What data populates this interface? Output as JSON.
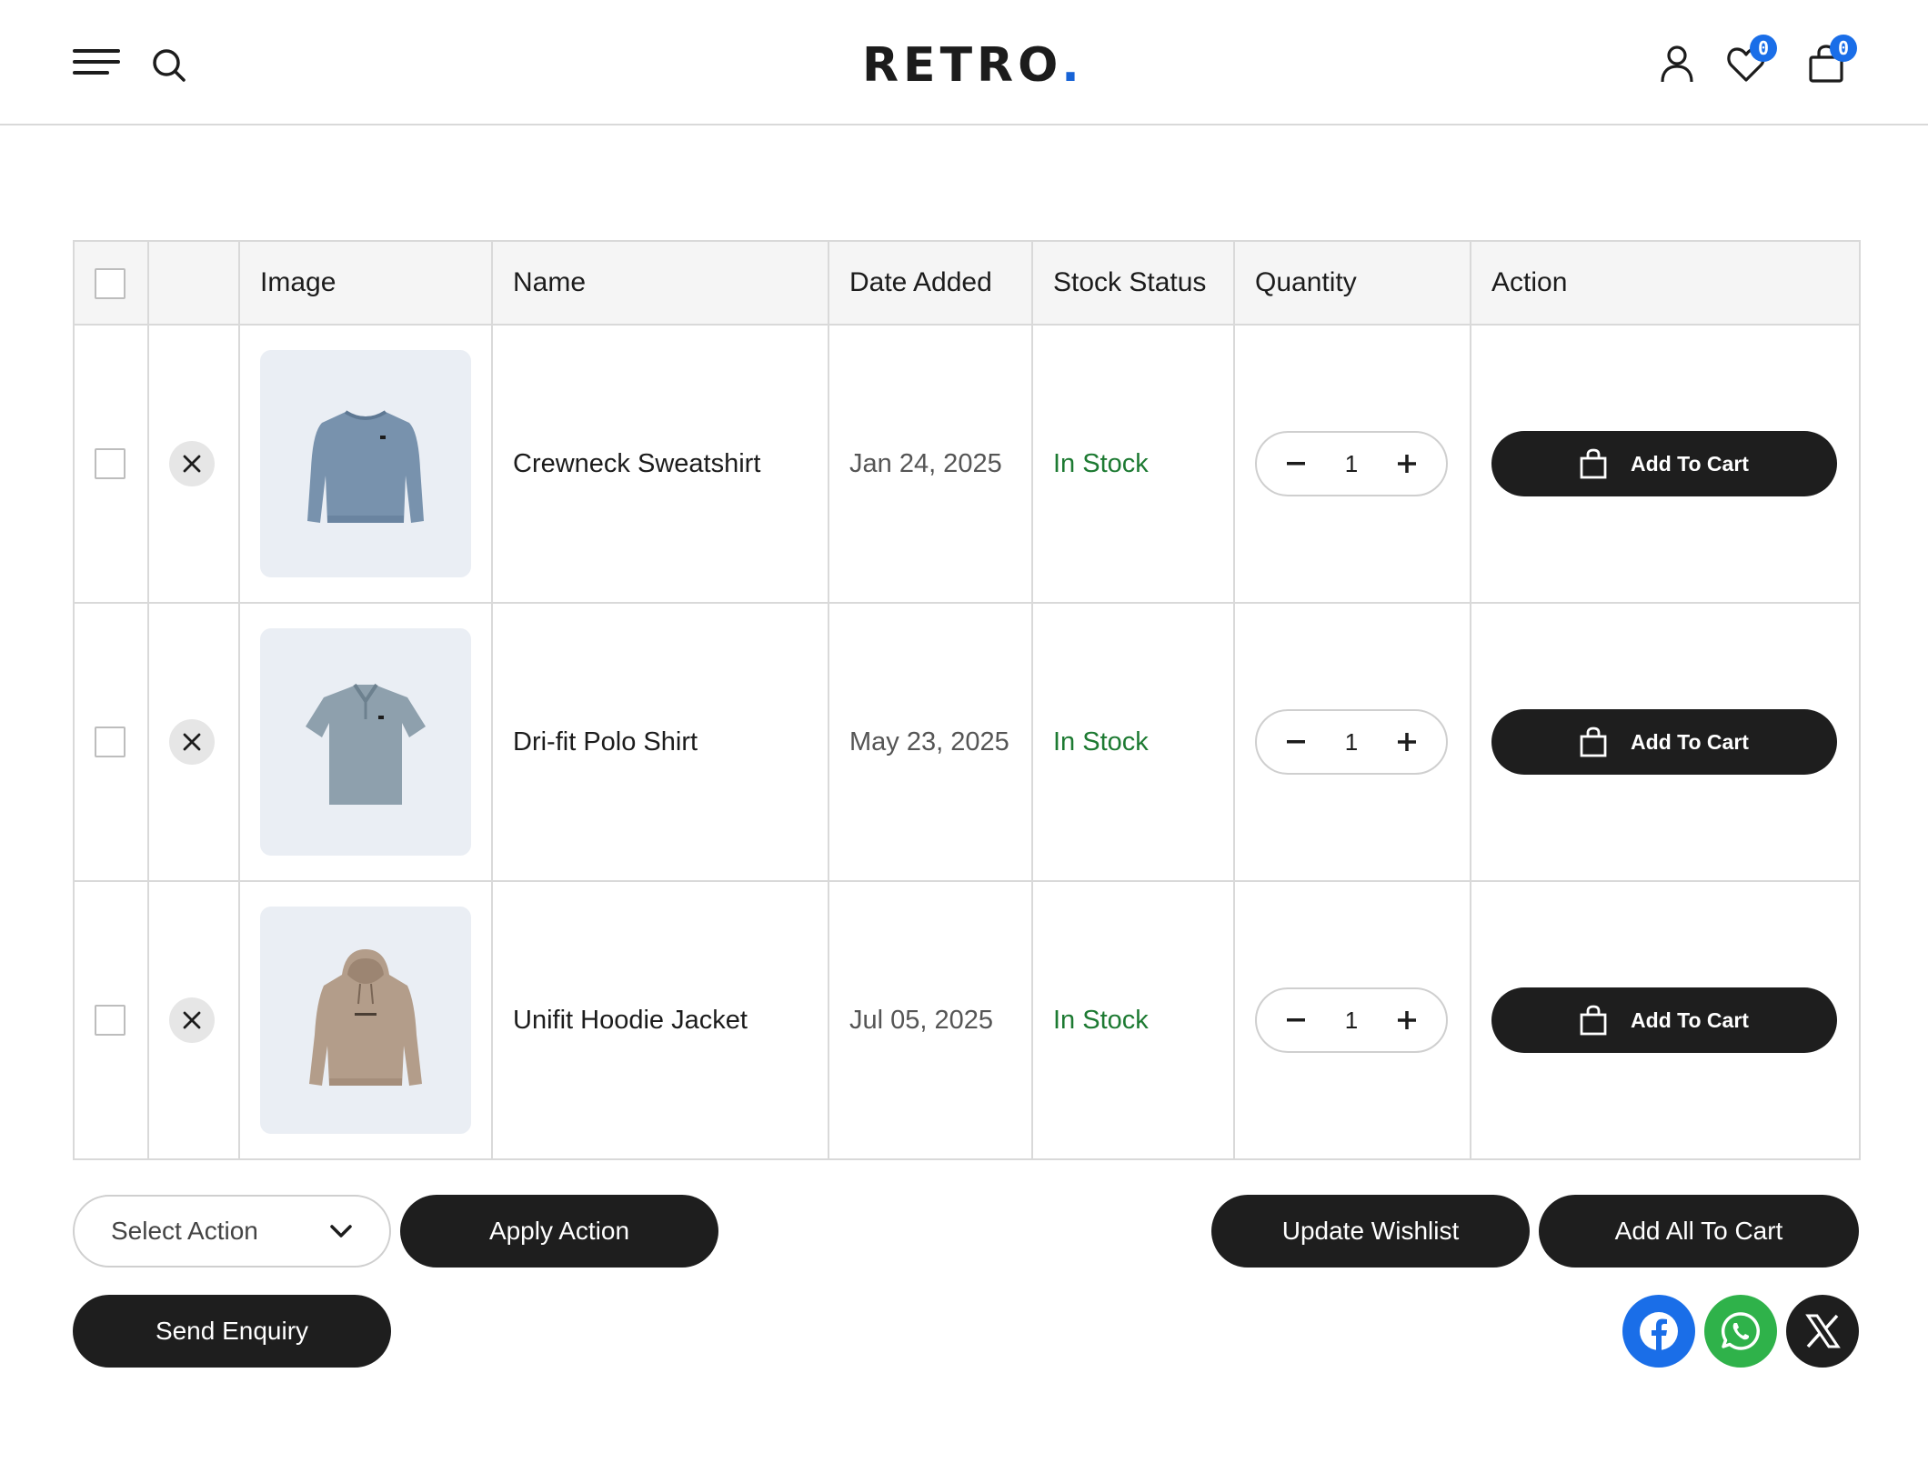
{
  "header": {
    "logo_text": "RETRO",
    "logo_dot": ".",
    "wishlist_count": "0",
    "cart_count": "0"
  },
  "table": {
    "columns": [
      "",
      "",
      "Image",
      "Name",
      "Date Added",
      "Stock Status",
      "Quantity",
      "Action"
    ],
    "rows": [
      {
        "name": "Crewneck Sweatshirt",
        "date": "Jan 24, 2025",
        "stock": "In Stock",
        "qty": "1",
        "action": "Add To Cart"
      },
      {
        "name": "Dri-fit Polo Shirt",
        "date": "May 23, 2025",
        "stock": "In Stock",
        "qty": "1",
        "action": "Add To Cart"
      },
      {
        "name": "Unifit Hoodie Jacket",
        "date": "Jul 05, 2025",
        "stock": "In Stock",
        "qty": "1",
        "action": "Add To Cart"
      }
    ]
  },
  "actions": {
    "select_action": "Select Action",
    "apply_action": "Apply Action",
    "update_wishlist": "Update Wishlist",
    "add_all_to_cart": "Add All To Cart",
    "send_enquiry": "Send Enquiry"
  },
  "social": [
    "facebook-icon",
    "whatsapp-icon",
    "x-icon"
  ],
  "colors": {
    "accent": "#1a6ee8",
    "in_stock": "#1d7a32",
    "dark_button": "#1e1e1e",
    "thumb_bg": "#eaeef4"
  }
}
